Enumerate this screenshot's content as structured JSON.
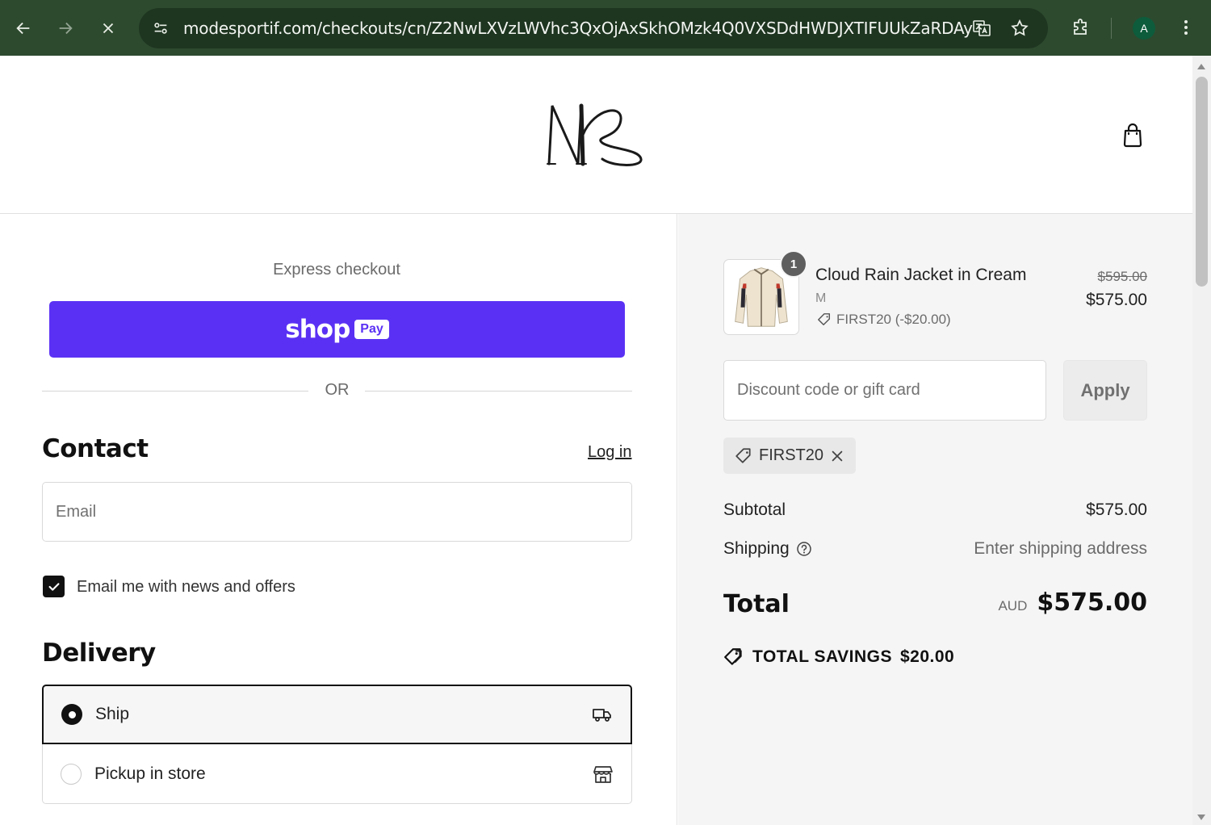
{
  "browser": {
    "url": "modesportif.com/checkouts/cn/Z2NwLXVzLWVhc3QxOjAxSkhOMzk4Q0VXSDdHWDJXTIFUUkZaRDAy",
    "avatar_letter": "A",
    "theme_color": "#2d4a2e"
  },
  "header": {
    "logo": "MS monogram logo",
    "cart_icon": "shopping-bag-icon"
  },
  "express": {
    "label": "Express checkout",
    "shop_word": "shop",
    "pay_word": "Pay",
    "button_color": "#5a31f4",
    "or_text": "OR"
  },
  "contact": {
    "title": "Contact",
    "login_label": "Log in",
    "email_placeholder": "Email",
    "email_value": "",
    "news_checkbox_label": "Email me with news and offers",
    "news_checked": true
  },
  "delivery": {
    "title": "Delivery",
    "options": [
      {
        "label": "Ship",
        "selected": true,
        "icon": "truck-icon"
      },
      {
        "label": "Pickup in store",
        "selected": false,
        "icon": "store-icon"
      }
    ]
  },
  "summary": {
    "item": {
      "quantity": "1",
      "name": "Cloud Rain Jacket in Cream",
      "variant": "M",
      "discount": "FIRST20 (-$20.00)",
      "original_price": "$595.00",
      "price": "$575.00"
    },
    "discount_placeholder": "Discount code or gift card",
    "apply_label": "Apply",
    "applied_code": "FIRST20",
    "subtotal_label": "Subtotal",
    "subtotal_value": "$575.00",
    "shipping_label": "Shipping",
    "shipping_value": "Enter shipping address",
    "total_label": "Total",
    "currency": "AUD",
    "total_value": "$575.00",
    "savings_label": "TOTAL SAVINGS",
    "savings_value": "$20.00"
  }
}
